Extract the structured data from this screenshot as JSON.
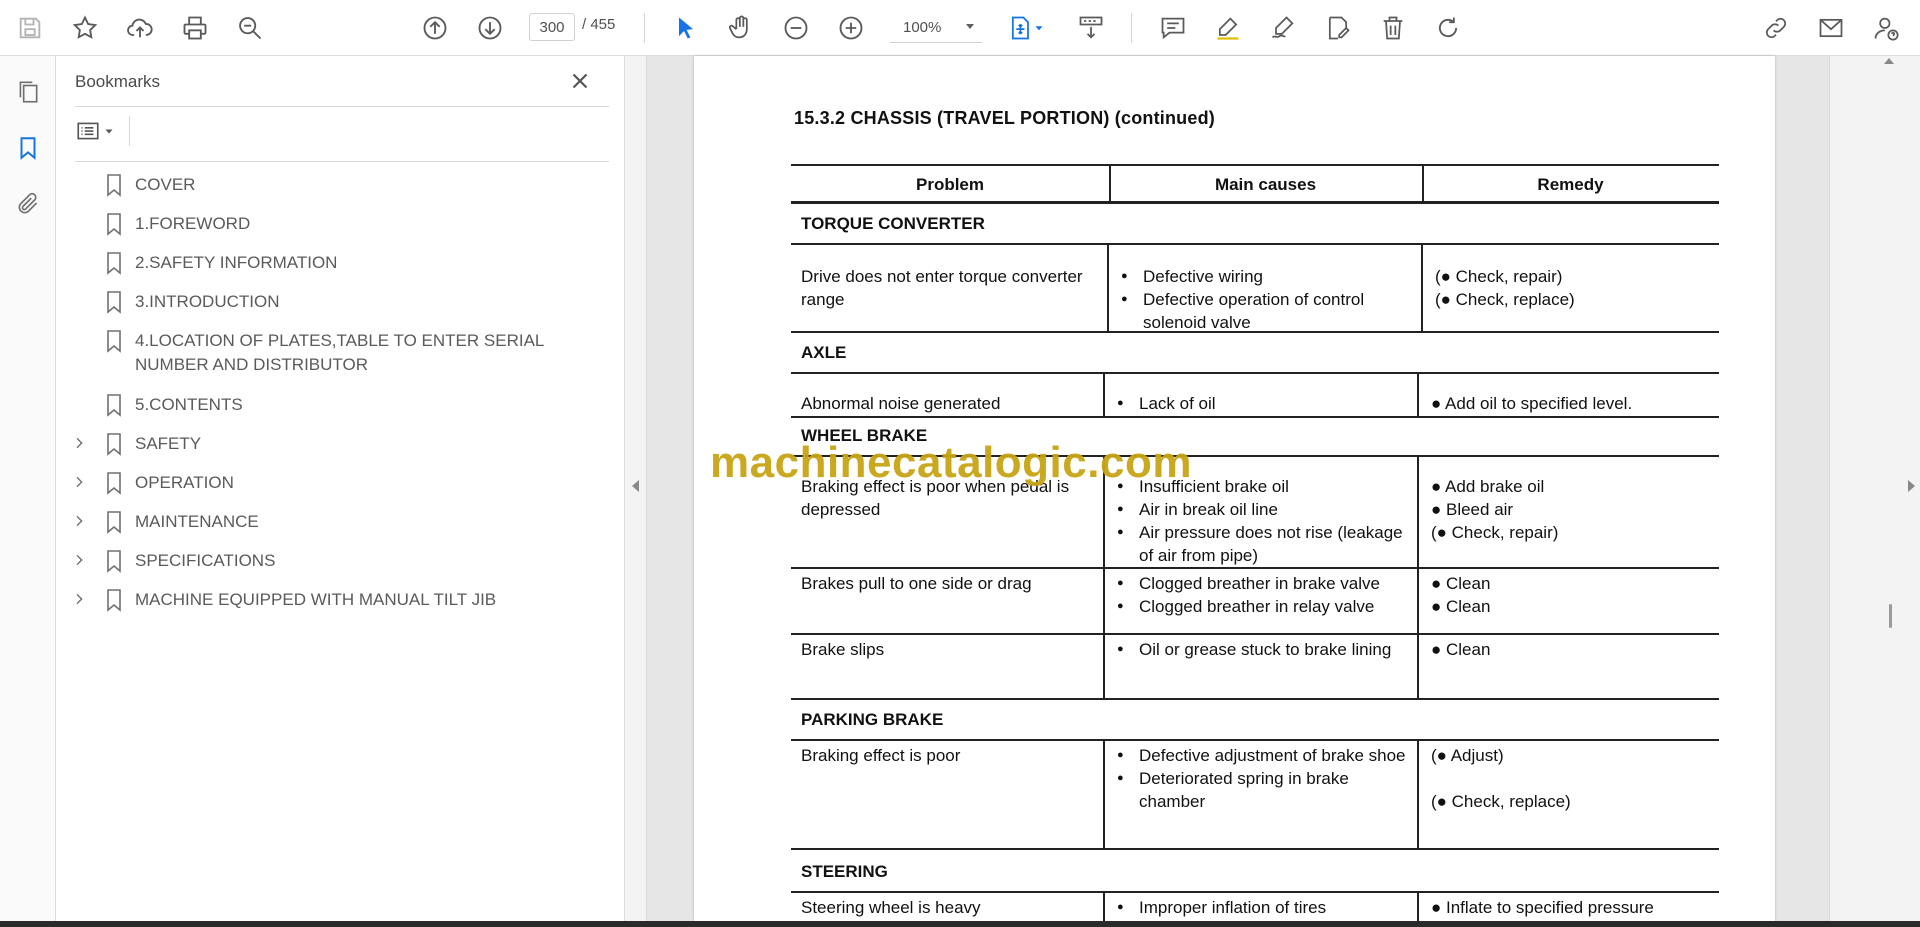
{
  "toolbar": {
    "page_current": "300",
    "page_total": "/ 455",
    "zoom": "100%"
  },
  "bookmarks": {
    "title": "Bookmarks",
    "items": [
      {
        "label": "COVER",
        "expandable": false
      },
      {
        "label": "1.FOREWORD",
        "expandable": false
      },
      {
        "label": "2.SAFETY INFORMATION",
        "expandable": false
      },
      {
        "label": "3.INTRODUCTION",
        "expandable": false
      },
      {
        "label": "4.LOCATION OF PLATES,TABLE TO ENTER SERIAL NUMBER AND DISTRIBUTOR",
        "expandable": false
      },
      {
        "label": "5.CONTENTS",
        "expandable": false
      },
      {
        "label": "SAFETY",
        "expandable": true
      },
      {
        "label": "OPERATION",
        "expandable": true
      },
      {
        "label": "MAINTENANCE",
        "expandable": true
      },
      {
        "label": "SPECIFICATIONS",
        "expandable": true
      },
      {
        "label": "MACHINE EQUIPPED WITH MANUAL TILT JIB",
        "expandable": true
      }
    ]
  },
  "document": {
    "title": "15.3.2 CHASSIS (TRAVEL PORTION) (continued)",
    "headers": [
      "Problem",
      "Main causes",
      "Remedy"
    ],
    "watermark": "machinecatalogic.com",
    "sections": [
      {
        "name": "TORQUE CONVERTER",
        "rows": [
          {
            "problem": "Drive does not enter torque converter range",
            "causes": [
              "Defective wiring",
              "Defective operation of control solenoid valve"
            ],
            "remedies": [
              "(● Check, repair)",
              "(● Check, replace)"
            ]
          }
        ]
      },
      {
        "name": "AXLE",
        "rows": [
          {
            "problem": "Abnormal noise generated",
            "causes": [
              "Lack of oil"
            ],
            "remedies": [
              "● Add oil to specified level."
            ]
          }
        ]
      },
      {
        "name": "WHEEL BRAKE",
        "rows": [
          {
            "problem": "Braking effect is poor when pedal is depressed",
            "causes": [
              "Insufficient brake oil",
              "Air in break oil line",
              "Air pressure does not rise (leakage of air from pipe)"
            ],
            "remedies": [
              "● Add brake oil",
              "● Bleed air",
              "(● Check, repair)"
            ]
          },
          {
            "problem": "Brakes pull to one side or drag",
            "causes": [
              "Clogged breather in brake valve",
              "Clogged breather in relay valve"
            ],
            "remedies": [
              "● Clean",
              "● Clean"
            ]
          },
          {
            "problem": "Brake slips",
            "causes": [
              "Oil or grease stuck to brake lining"
            ],
            "remedies": [
              "● Clean"
            ]
          }
        ]
      },
      {
        "name": "PARKING BRAKE",
        "rows": [
          {
            "problem": "Braking effect is poor",
            "causes": [
              "Defective adjustment of brake shoe",
              "Deteriorated spring in brake chamber"
            ],
            "remedies": [
              "(● Adjust)",
              "(● Check, replace)"
            ]
          }
        ]
      },
      {
        "name": "STEERING",
        "rows": [
          {
            "problem": "Steering wheel is heavy",
            "causes": [
              "Improper inflation of tires"
            ],
            "remedies": [
              "● Inflate to specified pressure"
            ]
          }
        ]
      }
    ]
  }
}
